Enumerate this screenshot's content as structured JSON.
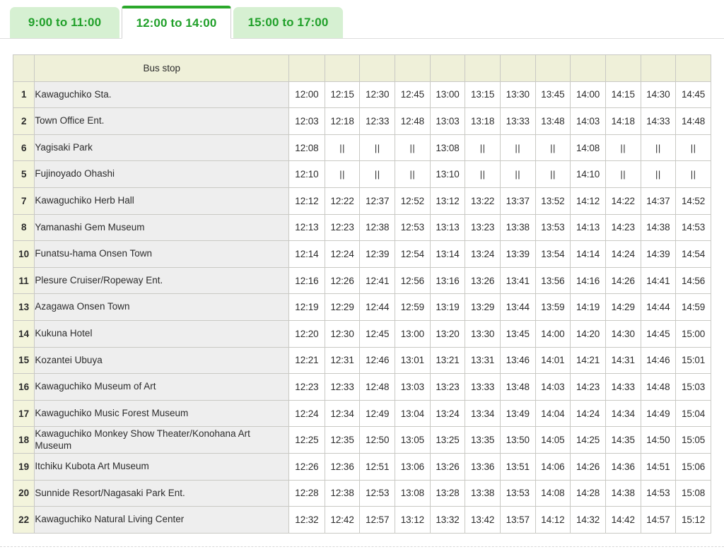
{
  "tabs": [
    {
      "label": "9:00 to 11:00",
      "active": false
    },
    {
      "label": "12:00 to 14:00",
      "active": true
    },
    {
      "label": "15:00 to 17:00",
      "active": false
    }
  ],
  "table": {
    "headers": {
      "number": "",
      "bus_stop": "Bus stop",
      "departures": [
        "",
        "",
        "",
        "",
        "",
        "",
        "",
        "",
        "",
        "",
        "",
        ""
      ]
    },
    "pass_symbol": "||",
    "rows": [
      {
        "no": "1",
        "stop": "Kawaguchiko Sta.",
        "times": [
          "12:00",
          "12:15",
          "12:30",
          "12:45",
          "13:00",
          "13:15",
          "13:30",
          "13:45",
          "14:00",
          "14:15",
          "14:30",
          "14:45"
        ]
      },
      {
        "no": "2",
        "stop": "Town Office Ent.",
        "times": [
          "12:03",
          "12:18",
          "12:33",
          "12:48",
          "13:03",
          "13:18",
          "13:33",
          "13:48",
          "14:03",
          "14:18",
          "14:33",
          "14:48"
        ]
      },
      {
        "no": "6",
        "stop": "Yagisaki Park",
        "times": [
          "12:08",
          "||",
          "||",
          "||",
          "13:08",
          "||",
          "||",
          "||",
          "14:08",
          "||",
          "||",
          "||"
        ]
      },
      {
        "no": "5",
        "stop": "Fujinoyado Ohashi",
        "times": [
          "12:10",
          "||",
          "||",
          "||",
          "13:10",
          "||",
          "||",
          "||",
          "14:10",
          "||",
          "||",
          "||"
        ]
      },
      {
        "no": "7",
        "stop": "Kawaguchiko Herb Hall",
        "times": [
          "12:12",
          "12:22",
          "12:37",
          "12:52",
          "13:12",
          "13:22",
          "13:37",
          "13:52",
          "14:12",
          "14:22",
          "14:37",
          "14:52"
        ]
      },
      {
        "no": "8",
        "stop": "Yamanashi Gem Museum",
        "times": [
          "12:13",
          "12:23",
          "12:38",
          "12:53",
          "13:13",
          "13:23",
          "13:38",
          "13:53",
          "14:13",
          "14:23",
          "14:38",
          "14:53"
        ]
      },
      {
        "no": "10",
        "stop": "Funatsu-hama Onsen Town",
        "times": [
          "12:14",
          "12:24",
          "12:39",
          "12:54",
          "13:14",
          "13:24",
          "13:39",
          "13:54",
          "14:14",
          "14:24",
          "14:39",
          "14:54"
        ]
      },
      {
        "no": "11",
        "stop": "Plesure Cruiser/Ropeway Ent.",
        "times": [
          "12:16",
          "12:26",
          "12:41",
          "12:56",
          "13:16",
          "13:26",
          "13:41",
          "13:56",
          "14:16",
          "14:26",
          "14:41",
          "14:56"
        ]
      },
      {
        "no": "13",
        "stop": "Azagawa Onsen Town",
        "times": [
          "12:19",
          "12:29",
          "12:44",
          "12:59",
          "13:19",
          "13:29",
          "13:44",
          "13:59",
          "14:19",
          "14:29",
          "14:44",
          "14:59"
        ]
      },
      {
        "no": "14",
        "stop": "Kukuna Hotel",
        "times": [
          "12:20",
          "12:30",
          "12:45",
          "13:00",
          "13:20",
          "13:30",
          "13:45",
          "14:00",
          "14:20",
          "14:30",
          "14:45",
          "15:00"
        ]
      },
      {
        "no": "15",
        "stop": "Kozantei Ubuya",
        "times": [
          "12:21",
          "12:31",
          "12:46",
          "13:01",
          "13:21",
          "13:31",
          "13:46",
          "14:01",
          "14:21",
          "14:31",
          "14:46",
          "15:01"
        ]
      },
      {
        "no": "16",
        "stop": "Kawaguchiko Museum of Art",
        "times": [
          "12:23",
          "12:33",
          "12:48",
          "13:03",
          "13:23",
          "13:33",
          "13:48",
          "14:03",
          "14:23",
          "14:33",
          "14:48",
          "15:03"
        ]
      },
      {
        "no": "17",
        "stop": "Kawaguchiko Music Forest Museum",
        "times": [
          "12:24",
          "12:34",
          "12:49",
          "13:04",
          "13:24",
          "13:34",
          "13:49",
          "14:04",
          "14:24",
          "14:34",
          "14:49",
          "15:04"
        ]
      },
      {
        "no": "18",
        "stop": "Kawaguchiko Monkey Show Theater/Konohana Art Museum",
        "times": [
          "12:25",
          "12:35",
          "12:50",
          "13:05",
          "13:25",
          "13:35",
          "13:50",
          "14:05",
          "14:25",
          "14:35",
          "14:50",
          "15:05"
        ]
      },
      {
        "no": "19",
        "stop": "Itchiku Kubota Art Museum",
        "times": [
          "12:26",
          "12:36",
          "12:51",
          "13:06",
          "13:26",
          "13:36",
          "13:51",
          "14:06",
          "14:26",
          "14:36",
          "14:51",
          "15:06"
        ]
      },
      {
        "no": "20",
        "stop": "Sunnide Resort/Nagasaki Park Ent.",
        "times": [
          "12:28",
          "12:38",
          "12:53",
          "13:08",
          "13:28",
          "13:38",
          "13:53",
          "14:08",
          "14:28",
          "14:38",
          "14:53",
          "15:08"
        ]
      },
      {
        "no": "22",
        "stop": "Kawaguchiko Natural Living Center",
        "times": [
          "12:32",
          "12:42",
          "12:57",
          "13:12",
          "13:32",
          "13:42",
          "13:57",
          "14:12",
          "14:32",
          "14:42",
          "14:57",
          "15:12"
        ]
      }
    ]
  },
  "colors": {
    "tab_active_text": "#21a02a",
    "tab_inactive_bg": "#d6f0d2",
    "tab_top_border": "#2aa82a",
    "header_bg": "#eff0d9",
    "number_col_bg": "#f3f4dc",
    "stop_col_bg": "#eeeeee",
    "grid_line": "#c9c9c4"
  }
}
